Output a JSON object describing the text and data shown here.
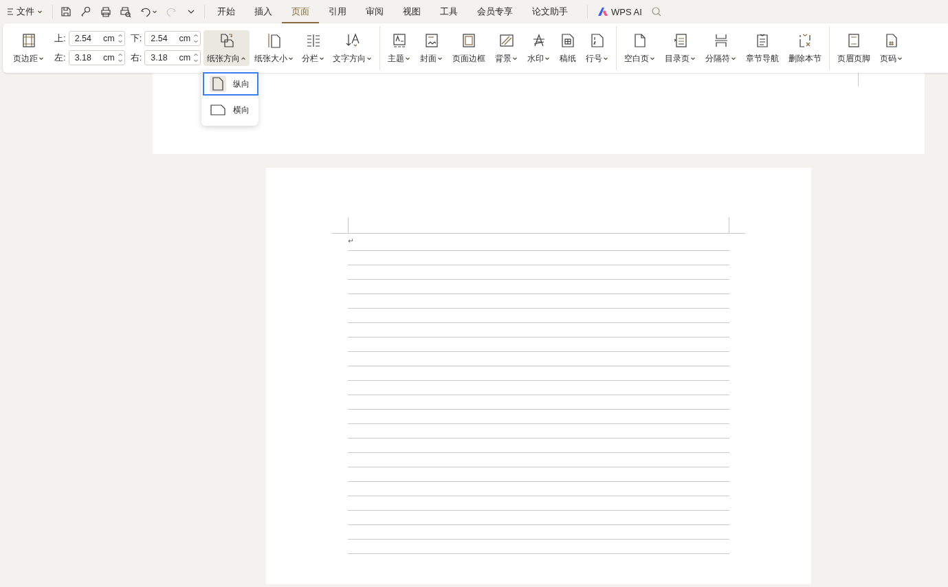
{
  "file_menu": {
    "label": "文件"
  },
  "tabs": [
    {
      "label": "开始",
      "selected": false
    },
    {
      "label": "插入",
      "selected": false
    },
    {
      "label": "页面",
      "selected": true
    },
    {
      "label": "引用",
      "selected": false
    },
    {
      "label": "审阅",
      "selected": false
    },
    {
      "label": "视图",
      "selected": false
    },
    {
      "label": "工具",
      "selected": false
    },
    {
      "label": "会员专享",
      "selected": false
    },
    {
      "label": "论文助手",
      "selected": false
    }
  ],
  "ai_button": {
    "label": "WPS AI"
  },
  "ribbon": {
    "margin_button": {
      "label": "页边距",
      "kind": "margins",
      "dropdown": true,
      "pressed": false
    },
    "margins": [
      {
        "label": "上:",
        "value": "2.54",
        "unit": "cm"
      },
      {
        "label": "下:",
        "value": "2.54",
        "unit": "cm"
      },
      {
        "label": "左:",
        "value": "3.18",
        "unit": "cm"
      },
      {
        "label": "右:",
        "value": "3.18",
        "unit": "cm"
      }
    ],
    "groups": [
      [
        {
          "label": "纸张方向",
          "kind": "orientation",
          "dropdown": true,
          "pressed": true
        },
        {
          "label": "纸张大小",
          "kind": "paper-size",
          "dropdown": true,
          "pressed": false
        },
        {
          "label": "分栏",
          "kind": "columns",
          "dropdown": true,
          "pressed": false
        },
        {
          "label": "文字方向",
          "kind": "text-direction",
          "dropdown": true,
          "pressed": false
        }
      ],
      [
        {
          "label": "主题",
          "kind": "theme",
          "dropdown": true,
          "pressed": false
        },
        {
          "label": "封面",
          "kind": "cover",
          "dropdown": true,
          "pressed": false
        },
        {
          "label": "页面边框",
          "kind": "border",
          "dropdown": false,
          "pressed": false
        },
        {
          "label": "背景",
          "kind": "background",
          "dropdown": true,
          "pressed": false
        },
        {
          "label": "水印",
          "kind": "watermark",
          "dropdown": true,
          "pressed": false
        },
        {
          "label": "稿纸",
          "kind": "manuscript",
          "dropdown": false,
          "pressed": false
        },
        {
          "label": "行号",
          "kind": "line-numbers",
          "dropdown": true,
          "pressed": false
        }
      ],
      [
        {
          "label": "空白页",
          "kind": "blank-page",
          "dropdown": true,
          "pressed": false
        },
        {
          "label": "目录页",
          "kind": "toc",
          "dropdown": true,
          "pressed": false
        },
        {
          "label": "分隔符",
          "kind": "separator",
          "dropdown": true,
          "pressed": false
        },
        {
          "label": "章节导航",
          "kind": "navigation",
          "dropdown": false,
          "pressed": false
        },
        {
          "label": "删除本节",
          "kind": "delete-section",
          "dropdown": false,
          "pressed": false
        }
      ],
      [
        {
          "label": "页眉页脚",
          "kind": "header-footer",
          "dropdown": false,
          "pressed": false
        },
        {
          "label": "页码",
          "kind": "page-number",
          "dropdown": true,
          "pressed": false
        }
      ]
    ]
  },
  "orientation_menu": {
    "items": [
      {
        "label": "纵向",
        "kind": "portrait",
        "selected": true
      },
      {
        "label": "横向",
        "kind": "landscape",
        "selected": false
      }
    ]
  },
  "document": {
    "paragraph_mark": "↵"
  }
}
